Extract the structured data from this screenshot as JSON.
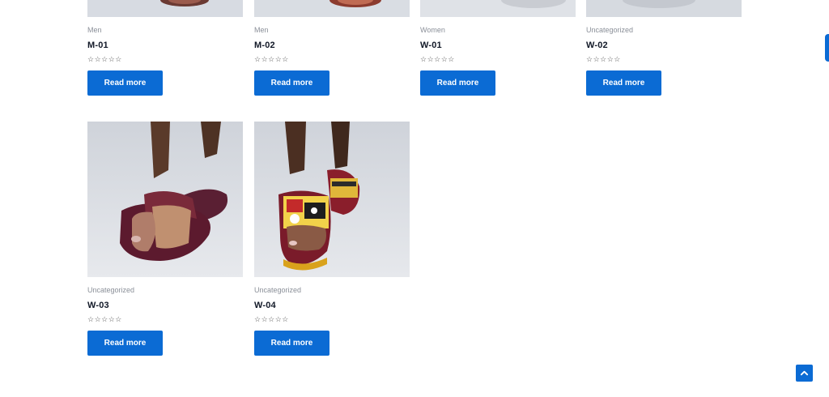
{
  "products": [
    {
      "category": "Men",
      "title": "M-01",
      "rating_label": "☆☆☆☆☆",
      "button": "Read more",
      "image": "sandal-photo-cropped"
    },
    {
      "category": "Men",
      "title": "M-02",
      "rating_label": "☆☆☆☆☆",
      "button": "Read more",
      "image": "sandal-photo-cropped"
    },
    {
      "category": "Women",
      "title": "W-01",
      "rating_label": "☆☆☆☆☆",
      "button": "Read more",
      "image": "sandal-photo-cropped"
    },
    {
      "category": "Uncategorized",
      "title": "W-02",
      "rating_label": "☆☆☆☆☆",
      "button": "Read more",
      "image": "sandal-photo-cropped"
    },
    {
      "category": "Uncategorized",
      "title": "W-03",
      "rating_label": "☆☆☆☆☆",
      "button": "Read more",
      "image": "brown-leather-slide-sandal-photo"
    },
    {
      "category": "Uncategorized",
      "title": "W-04",
      "rating_label": "☆☆☆☆☆",
      "button": "Read more",
      "image": "patterned-kente-slide-sandal-photo"
    }
  ],
  "ui": {
    "accent_color": "#0b6bd4",
    "scroll_top_icon": "chevron-up-icon"
  }
}
